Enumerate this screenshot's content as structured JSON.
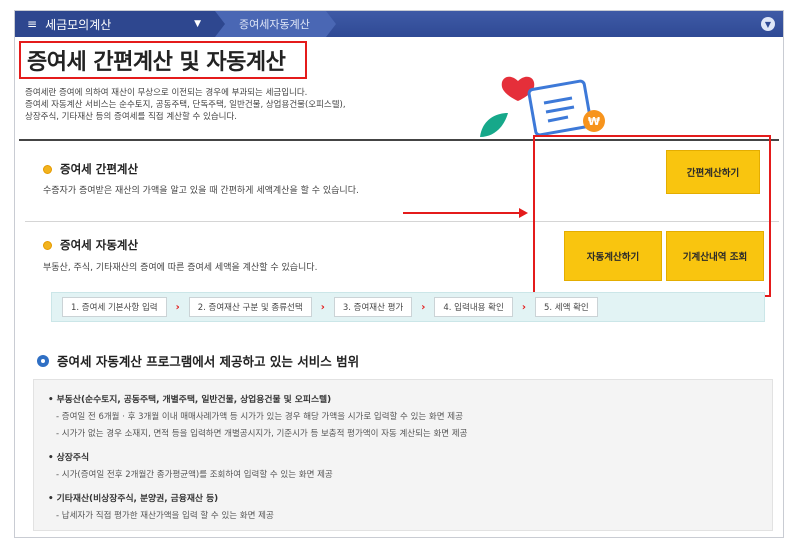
{
  "topbar": {
    "menu_label": "세금모의계산",
    "menu_icon": "hamburger-icon",
    "crumb": "증여세자동계산"
  },
  "page": {
    "title": "증여세 간편계산 및 자동계산",
    "intro": [
      "증여세란 증여에 의하여 재산이 무상으로 이전되는 경우에 부과되는 세금입니다.",
      "증여세 자동계산 서비스는 순수토지, 공동주택, 단독주택, 일반건물, 상업용건물(오피스텔),",
      "상장주식, 기타재산 등의 증여세를 직접 계산할 수 있습니다."
    ]
  },
  "simple_calc": {
    "title": "증여세 간편계산",
    "desc": "수증자가 증여받은 재산의 가액을 알고 있을 때 간편하게 세액계산을 할 수 있습니다.",
    "button": "간편계산하기"
  },
  "auto_calc": {
    "title": "증여세 자동계산",
    "desc": "부동산, 주식, 기타재산의 증여에 따른 증여세 세액을 계산할 수 있습니다.",
    "button_auto": "자동계산하기",
    "button_history": "기계산내역 조회"
  },
  "steps": [
    "1. 증여세 기본사항 입력",
    "2. 증여재산 구분 및 종류선택",
    "3. 증여재산 평가",
    "4. 입력내용 확인",
    "5. 세액 확인"
  ],
  "services": {
    "heading": "증여세 자동계산 프로그램에서 제공하고 있는 서비스 범위",
    "categories": [
      {
        "title": "• 부동산(순수토지, 공동주택, 개별주택, 일반건물, 상업용건물 및 오피스텔)",
        "items": [
          "- 증여일 전 6개월 · 후 3개월 이내 매매사례가액 등 시가가 있는 경우 해당 가액을 시가로 입력할 수 있는 화면 제공",
          "- 시가가 없는 경우 소재지, 면적 등을 입력하면 개별공시지가, 기준시가 등 보충적 평가액이 자동 계산되는 화면 제공"
        ]
      },
      {
        "title": "• 상장주식",
        "items": [
          "- 시가(증여일 전후 2개월간 종가평균액)를 조회하여 입력할 수 있는 화면 제공"
        ]
      },
      {
        "title": "• 기타재산(비상장주식, 분양권, 금융재산 등)",
        "items": [
          "- 납세자가 직접 평가한 재산가액을 입력 할 수 있는 화면 제공"
        ]
      }
    ]
  },
  "colors": {
    "nav_bar": "#2f4a95",
    "highlight_red": "#e41b1b",
    "button_yellow": "#f9c50f",
    "steps_bg": "#e2f3f4"
  }
}
